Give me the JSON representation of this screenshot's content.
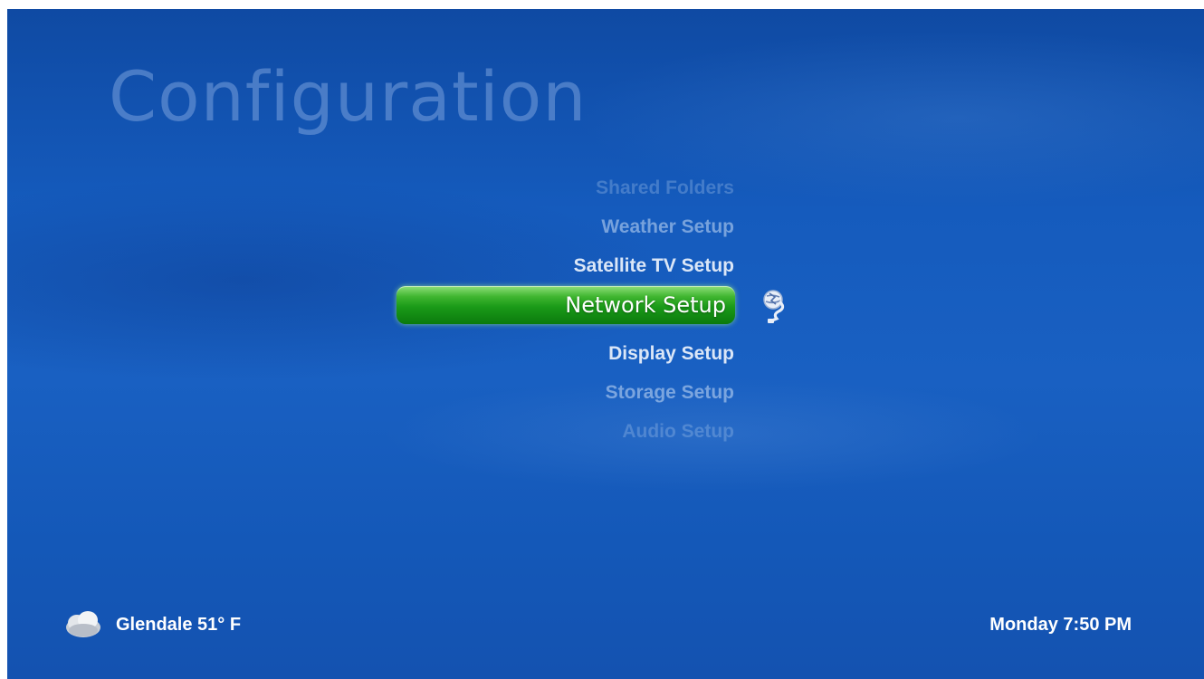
{
  "page": {
    "title": "Configuration"
  },
  "menu": {
    "items_above": [
      {
        "label": "Shared Folders"
      },
      {
        "label": "Weather Setup"
      },
      {
        "label": "Satellite TV Setup"
      }
    ],
    "selected": {
      "label": "Network Setup",
      "icon": "network-globe-icon"
    },
    "items_below": [
      {
        "label": "Display Setup"
      },
      {
        "label": "Storage Setup"
      },
      {
        "label": "Audio Setup"
      }
    ]
  },
  "footer": {
    "weather": {
      "icon": "cloudy-weather-icon",
      "text": "Glendale 51° F"
    },
    "datetime": "Monday 7:50 PM"
  },
  "colors": {
    "background": "#155bbd",
    "selection": "#1a9a18",
    "text": "#ffffff"
  }
}
